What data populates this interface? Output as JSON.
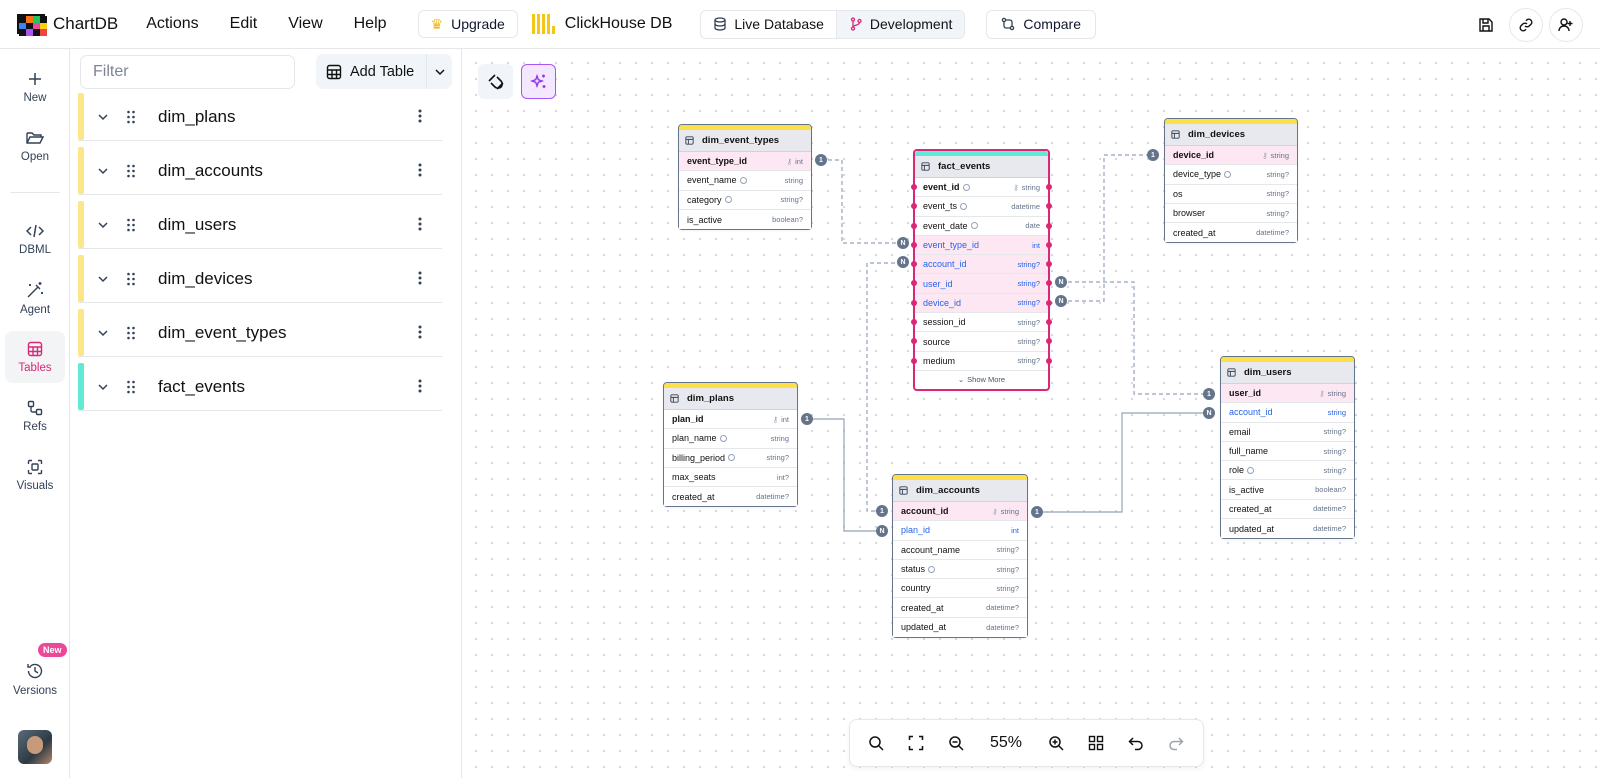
{
  "app": {
    "name": "ChartDB"
  },
  "menu": [
    "Actions",
    "Edit",
    "View",
    "Help"
  ],
  "upgrade_label": "Upgrade",
  "database": {
    "name": "ClickHouse DB"
  },
  "env_tabs": [
    {
      "label": "Live Database",
      "active": false
    },
    {
      "label": "Development",
      "active": true
    }
  ],
  "compare_label": "Compare",
  "rail": {
    "new": "New",
    "open": "Open",
    "dbml": "DBML",
    "agent": "Agent",
    "tables": "Tables",
    "refs": "Refs",
    "visuals": "Visuals",
    "versions": "Versions",
    "versions_badge": "New"
  },
  "panel": {
    "filter_placeholder": "Filter",
    "add_table": "Add Table",
    "tables": [
      {
        "name": "dim_plans",
        "color": "#fde68a"
      },
      {
        "name": "dim_accounts",
        "color": "#fde68a"
      },
      {
        "name": "dim_users",
        "color": "#fde68a"
      },
      {
        "name": "dim_devices",
        "color": "#fde68a"
      },
      {
        "name": "dim_event_types",
        "color": "#fde68a"
      },
      {
        "name": "fact_events",
        "color": "#5eead4"
      }
    ]
  },
  "diagram": {
    "tables": {
      "dim_event_types": {
        "name": "dim_event_types",
        "color": "#fde047",
        "fields": [
          {
            "name": "event_type_id",
            "type": "int",
            "pk": true
          },
          {
            "name": "event_name",
            "type": "string",
            "comment": true
          },
          {
            "name": "category",
            "type": "string?",
            "comment": true
          },
          {
            "name": "is_active",
            "type": "boolean?"
          }
        ]
      },
      "fact_events": {
        "name": "fact_events",
        "color": "#5eead4",
        "show_more": "Show More",
        "fields": [
          {
            "name": "event_id",
            "type": "string",
            "pk": true,
            "comment": true
          },
          {
            "name": "event_ts",
            "type": "datetime",
            "comment": true
          },
          {
            "name": "event_date",
            "type": "date",
            "comment": true
          },
          {
            "name": "event_type_id",
            "type": "int",
            "fk": true
          },
          {
            "name": "account_id",
            "type": "string?",
            "fk": true
          },
          {
            "name": "user_id",
            "type": "string?",
            "fk": true
          },
          {
            "name": "device_id",
            "type": "string?",
            "fk": true
          },
          {
            "name": "session_id",
            "type": "string?"
          },
          {
            "name": "source",
            "type": "string?"
          },
          {
            "name": "medium",
            "type": "string?"
          }
        ]
      },
      "dim_devices": {
        "name": "dim_devices",
        "color": "#fde047",
        "fields": [
          {
            "name": "device_id",
            "type": "string",
            "pk": true
          },
          {
            "name": "device_type",
            "type": "string?",
            "comment": true
          },
          {
            "name": "os",
            "type": "string?"
          },
          {
            "name": "browser",
            "type": "string?"
          },
          {
            "name": "created_at",
            "type": "datetime?"
          }
        ]
      },
      "dim_plans": {
        "name": "dim_plans",
        "color": "#fde047",
        "fields": [
          {
            "name": "plan_id",
            "type": "int",
            "pk": true
          },
          {
            "name": "plan_name",
            "type": "string",
            "comment": true
          },
          {
            "name": "billing_period",
            "type": "string?",
            "comment": true
          },
          {
            "name": "max_seats",
            "type": "int?"
          },
          {
            "name": "created_at",
            "type": "datetime?"
          }
        ]
      },
      "dim_accounts": {
        "name": "dim_accounts",
        "color": "#fde047",
        "fields": [
          {
            "name": "account_id",
            "type": "string",
            "pk": true
          },
          {
            "name": "plan_id",
            "type": "int",
            "fk": true
          },
          {
            "name": "account_name",
            "type": "string?"
          },
          {
            "name": "status",
            "type": "string?",
            "comment": true
          },
          {
            "name": "country",
            "type": "string?"
          },
          {
            "name": "created_at",
            "type": "datetime?"
          },
          {
            "name": "updated_at",
            "type": "datetime?"
          }
        ]
      },
      "dim_users": {
        "name": "dim_users",
        "color": "#fde047",
        "fields": [
          {
            "name": "user_id",
            "type": "string",
            "pk": true
          },
          {
            "name": "account_id",
            "type": "string",
            "fk": true
          },
          {
            "name": "email",
            "type": "string?"
          },
          {
            "name": "full_name",
            "type": "string?"
          },
          {
            "name": "role",
            "type": "string?",
            "comment": true
          },
          {
            "name": "is_active",
            "type": "boolean?"
          },
          {
            "name": "created_at",
            "type": "datetime?"
          },
          {
            "name": "updated_at",
            "type": "datetime?"
          }
        ]
      }
    },
    "cardinality": {
      "one": "1",
      "many": "N"
    }
  },
  "zoom": {
    "level": "55%"
  }
}
